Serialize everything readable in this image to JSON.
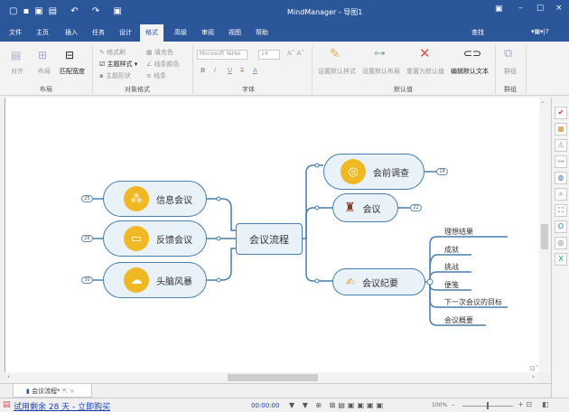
{
  "window": {
    "title": "MindManager - 导图1"
  },
  "quick_access": {
    "icons": [
      "new-icon",
      "open-icon",
      "save-icon",
      "print-icon",
      "undo-icon",
      "redo-icon",
      "help-icon"
    ]
  },
  "tabs": [
    "文件",
    "主页",
    "插入",
    "任务",
    "设计",
    "格式",
    "高级",
    "审阅",
    "视图",
    "帮助"
  ],
  "active_tab": "格式",
  "find_label": "查找",
  "ribbon": {
    "layout": {
      "align": "对齐",
      "layout": "布局",
      "match_width": "匹配宽度",
      "group": "布局"
    },
    "object_format": {
      "format_painter": "格式刷",
      "theme_style": "主题样式",
      "theme_shape": "主题形状",
      "fill_color": "填充色",
      "line_color": "线条颜色",
      "line": "线条",
      "group": "对象格式"
    },
    "font": {
      "name": "Microsoft YaHei",
      "size": "14",
      "bold": "B",
      "italic": "I",
      "underline": "U",
      "strike": "T",
      "color": "A",
      "group": "字体"
    },
    "defaults": {
      "set_style": "设置默认样式",
      "set_layout": "设置默认布局",
      "reset": "重置为默认值",
      "edit_text": "编辑默认文本",
      "group": "默认值"
    },
    "grouping": {
      "group_btn": "群组",
      "group": "群组"
    }
  },
  "map": {
    "central": "会议流程",
    "left": [
      {
        "label": "信息会议",
        "count": "25"
      },
      {
        "label": "反馈会议",
        "count": "26"
      },
      {
        "label": "头脑风暴",
        "count": "30"
      }
    ],
    "right": [
      {
        "label": "会前调查",
        "count": "14"
      },
      {
        "label": "会议",
        "count": "22"
      },
      {
        "label": "会议纪要"
      }
    ],
    "minutes_children": [
      "理想结果",
      "成就",
      "挑战",
      "便笺",
      "下一次会议的目标",
      "会议概要"
    ]
  },
  "doc_tab": {
    "label": "会议流程*"
  },
  "status": {
    "trial": "试用剩余 28 天 - 立即购买",
    "timer": "00:00:00",
    "zoom": "100%"
  },
  "colors": {
    "title_bar": "#2b579a",
    "node_border": "#4a7fae",
    "node_fill": "#e9f1f9",
    "icon_fill": "#f0b823"
  }
}
